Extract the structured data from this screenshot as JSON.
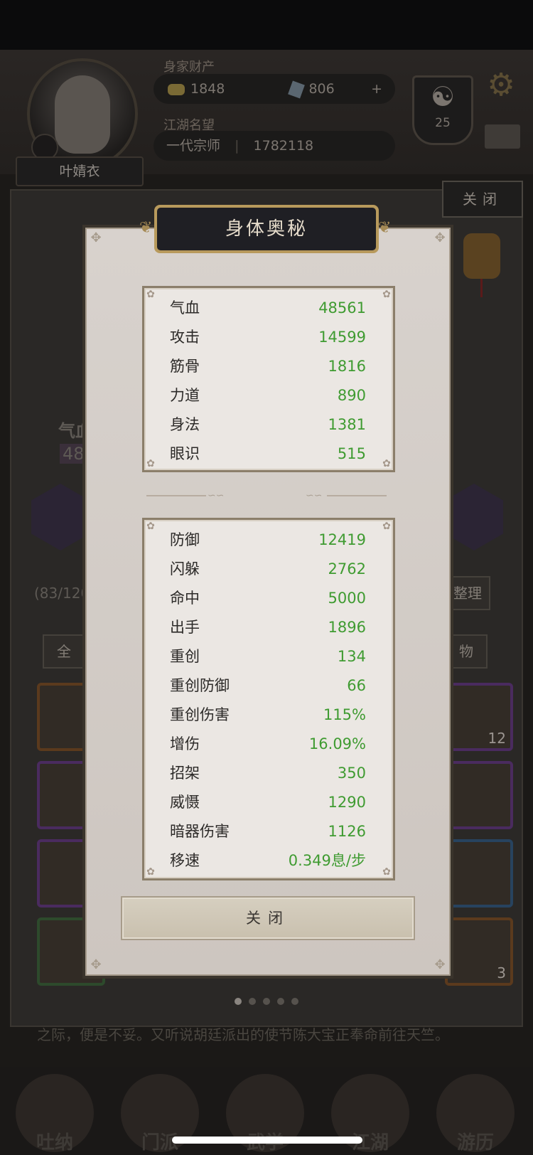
{
  "background": {
    "player": {
      "name": "叶婧衣",
      "wealth_label": "身家财产",
      "gold": "1848",
      "gems": "806",
      "add_symbol": "+",
      "fame_label": "江湖名望",
      "title": "一代宗师",
      "fame_value": "1782118"
    },
    "badge_level": "25",
    "badge_symbol": "☯",
    "gear_symbol": "⚙",
    "close_tab_label": "关闭",
    "char_power_label": "气血",
    "char_power_value": "48",
    "inventory_count": "(83/120",
    "sort_label": "整理",
    "filter_all": "全",
    "filter_item": "物",
    "slot_counts": [
      "12",
      "3"
    ],
    "story_text": "之际，便是不妥。又听说胡廷派出的使节陈大宝正奉命前往天竺。",
    "nav": [
      "吐纳",
      "门派",
      "武学",
      "江湖",
      "游历"
    ]
  },
  "modal": {
    "title": "身体奥秘",
    "corner_ornament": "✥",
    "top_stats": [
      {
        "label": "气血",
        "value": "48561"
      },
      {
        "label": "攻击",
        "value": "14599"
      },
      {
        "label": "筋骨",
        "value": "1816"
      },
      {
        "label": "力道",
        "value": "890"
      },
      {
        "label": "身法",
        "value": "1381"
      },
      {
        "label": "眼识",
        "value": "515"
      }
    ],
    "bottom_stats": [
      {
        "label": "防御",
        "value": "12419"
      },
      {
        "label": "闪躲",
        "value": "2762"
      },
      {
        "label": "命中",
        "value": "5000"
      },
      {
        "label": "出手",
        "value": "1896"
      },
      {
        "label": "重创",
        "value": "134"
      },
      {
        "label": "重创防御",
        "value": "66"
      },
      {
        "label": "重创伤害",
        "value": "115%"
      },
      {
        "label": "增伤",
        "value": "16.09%"
      },
      {
        "label": "招架",
        "value": "350"
      },
      {
        "label": "威慑",
        "value": "1290"
      },
      {
        "label": "暗器伤害",
        "value": "1126"
      },
      {
        "label": "移速",
        "value": "0.349息/步"
      }
    ],
    "close_label": "关闭",
    "colors": {
      "value_green": "#3f9b31",
      "title_bg": "#1f1f24",
      "title_frame": "#b89a5c",
      "modal_bg": "#d8d2cd"
    }
  }
}
